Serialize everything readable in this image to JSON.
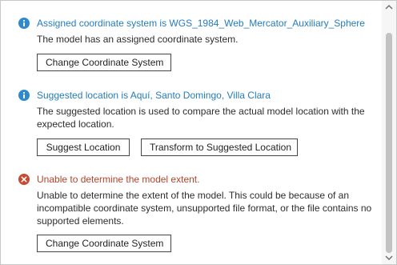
{
  "colors": {
    "info": "#237dbd",
    "error": "#b5432a"
  },
  "sections": [
    {
      "icon": "info-icon",
      "title": "Assigned coordinate system is WGS_1984_Web_Mercator_Auxiliary_Sphere",
      "description": "The model has an assigned coordinate system.",
      "buttons": [
        "Change Coordinate System"
      ]
    },
    {
      "icon": "info-icon",
      "title": "Suggested location is Aquí, Santo Domingo, Villa Clara",
      "description": "The suggested location is used to compare the actual model location with the expected location.",
      "buttons": [
        "Suggest Location",
        "Transform to Suggested Location"
      ]
    },
    {
      "icon": "error-icon",
      "title": "Unable to determine the model extent.",
      "description": "Unable to determine the extent of the model. This could be because of an incompatible coordinate system, unsupported file format, or the file contains no supported elements.",
      "buttons": [
        "Change Coordinate System"
      ]
    }
  ]
}
